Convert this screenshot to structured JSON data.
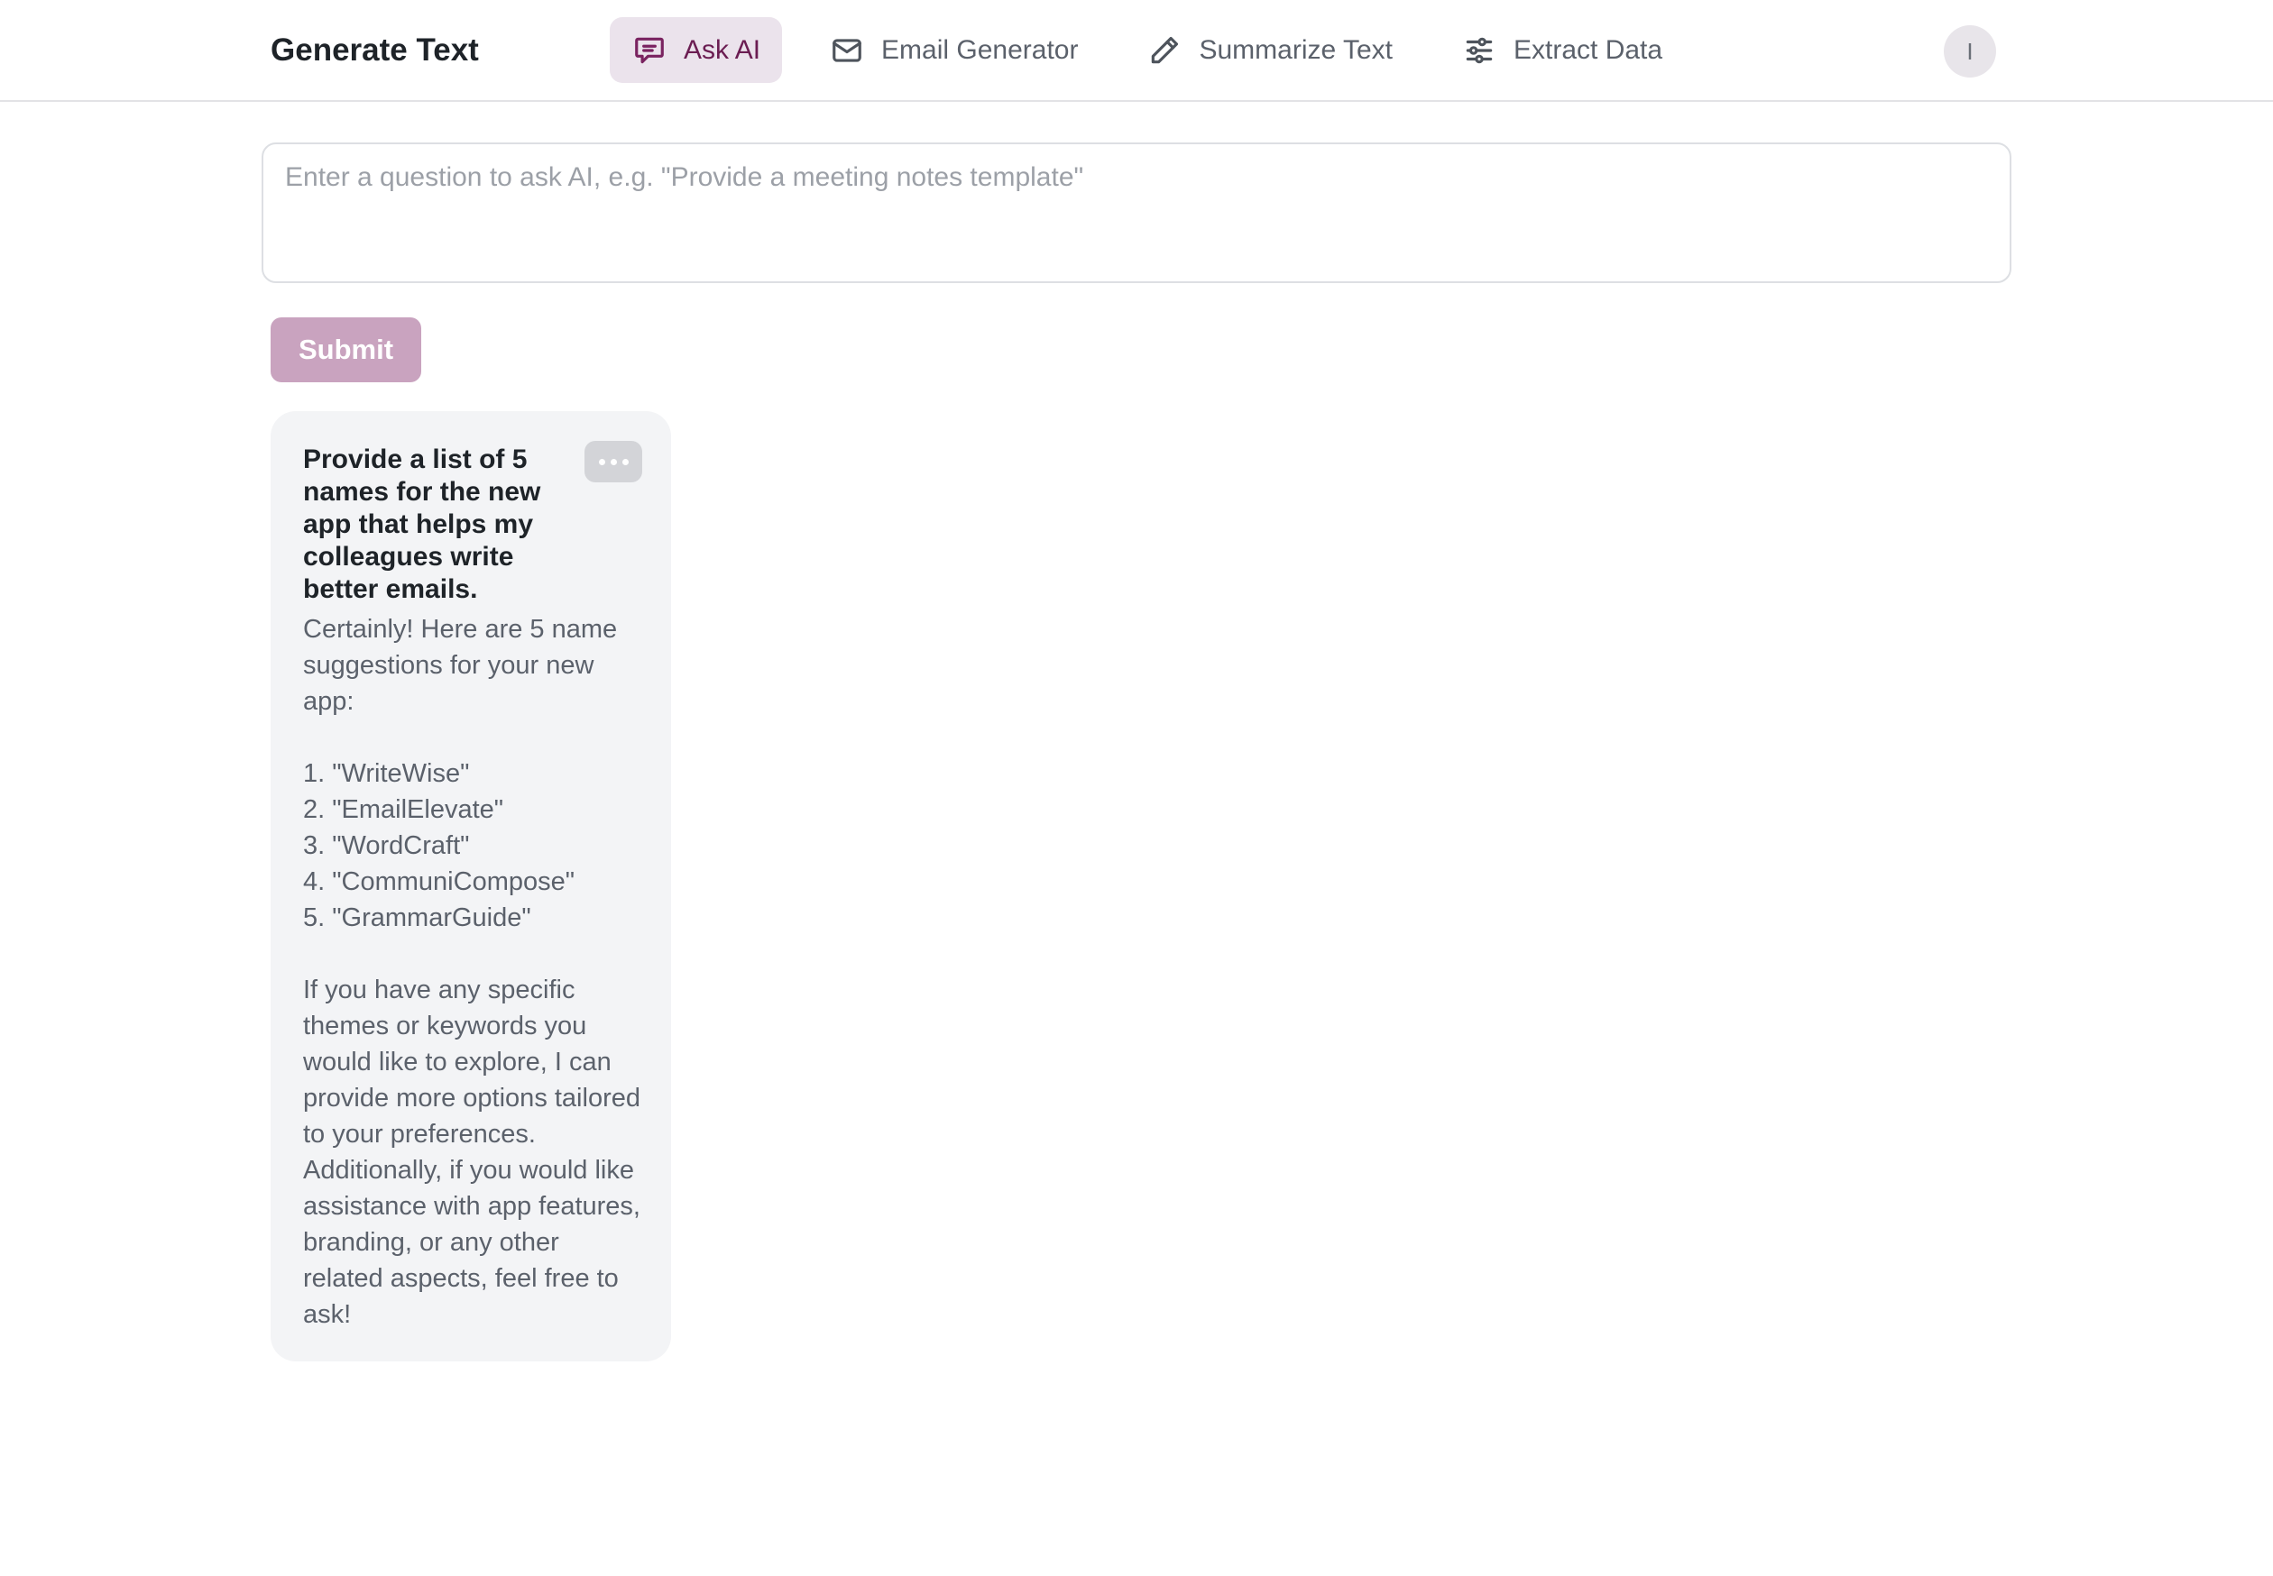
{
  "header": {
    "title": "Generate Text",
    "nav": [
      {
        "label": "Ask AI",
        "icon": "chat-bubble-icon",
        "active": true
      },
      {
        "label": "Email Generator",
        "icon": "envelope-icon",
        "active": false
      },
      {
        "label": "Summarize Text",
        "icon": "pencil-icon",
        "active": false
      },
      {
        "label": "Extract Data",
        "icon": "sliders-icon",
        "active": false
      }
    ],
    "avatar_initial": "I"
  },
  "prompt": {
    "placeholder": "Enter a question to ask AI, e.g. \"Provide a meeting notes template\"",
    "value": ""
  },
  "submit_label": "Submit",
  "card": {
    "question": "Provide a list of 5 names for the new app that helps my colleagues write better emails.",
    "intro": "Certainly! Here are 5 name suggestions for your new app:",
    "items": [
      "1. \"WriteWise\"",
      "2. \"EmailElevate\"",
      "3. \"WordCraft\"",
      "4. \"CommuniCompose\"",
      "5. \"GrammarGuide\""
    ],
    "outro": "If you have any specific themes or keywords you would like to explore, I can provide more options tailored to your preferences. Additionally, if you would like assistance with app features, branding, or any other related aspects, feel free to ask!"
  },
  "colors": {
    "accent": "#6b1d52",
    "active_tab_bg": "#ebe3ec",
    "submit_bg": "#c9a3bf",
    "card_bg": "#f3f4f6"
  }
}
